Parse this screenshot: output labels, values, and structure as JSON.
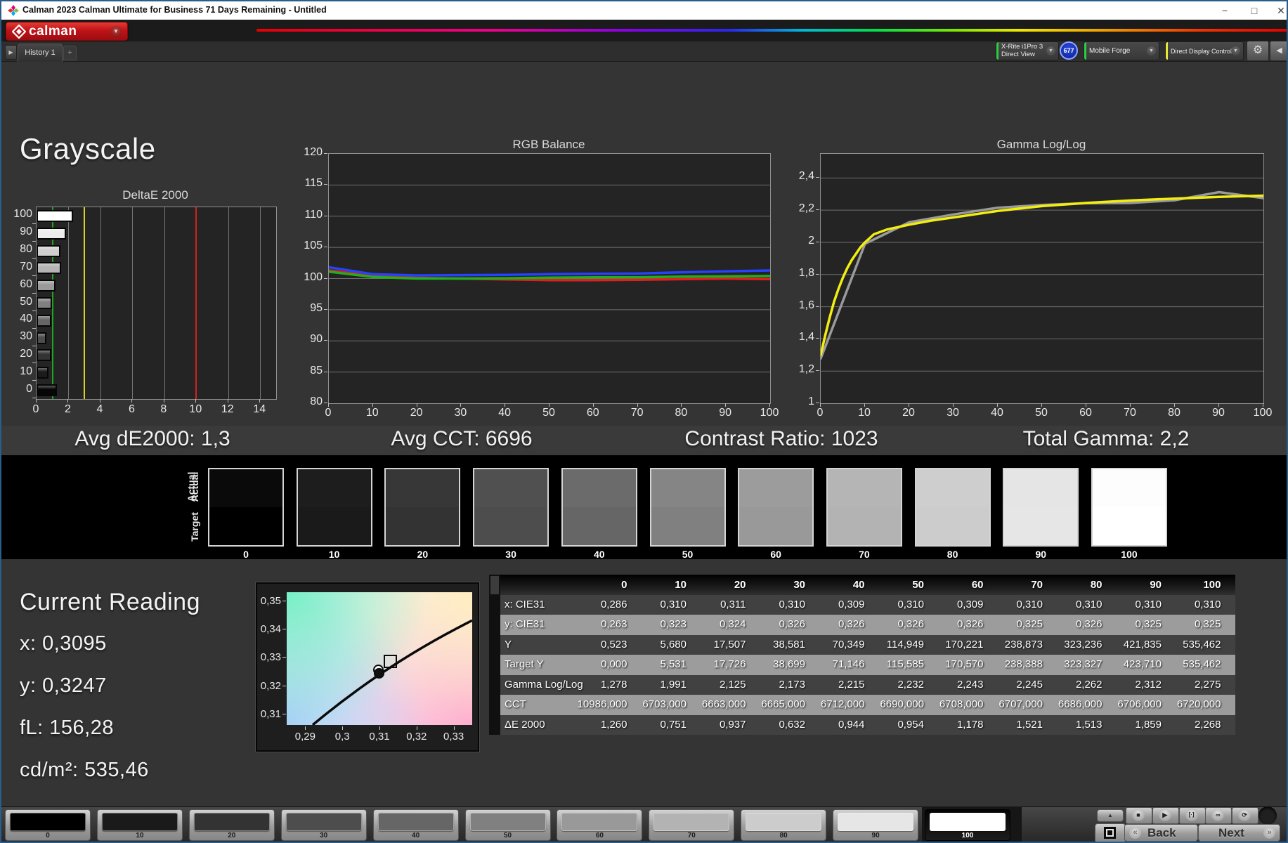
{
  "window": {
    "title": "Calman 2023 Calman Ultimate for Business 71 Days Remaining  - Untitled",
    "controls": [
      "−",
      "□",
      "✕"
    ]
  },
  "brand": {
    "logo_text": "calman"
  },
  "icons": {
    "caret_down": "▼",
    "tab_scroll": "▶",
    "gear": "⚙",
    "collapse": "◀",
    "up_arrow": "▲",
    "back_chevron": "«",
    "next_chevron": "»"
  },
  "toolbar": {
    "tab_label": "History 1",
    "add_label": "+",
    "meter": {
      "line1": "X-Rite i1Pro 3",
      "line2": "Direct View",
      "edge_color": "#2ecc40"
    },
    "meter_badge": "677",
    "source": {
      "label": "Mobile Forge",
      "edge_color": "#2ecc40"
    },
    "display": {
      "label": "Direct Display Control",
      "edge_color": "#e7e73a"
    }
  },
  "page": {
    "title": "Grayscale"
  },
  "summary": [
    "Avg dE2000: 1,3",
    "Avg CCT: 6696",
    "Contrast Ratio: 1023",
    "Total Gamma: 2,2"
  ],
  "reading": {
    "title": "Current Reading",
    "lines": [
      "x: 0,3095",
      "y: 0,3247",
      "fL: 156,28",
      "cd/m²: 535,46"
    ]
  },
  "swatches": {
    "row_labels": [
      "Actual",
      "Target"
    ],
    "levels": [
      "0",
      "10",
      "20",
      "30",
      "40",
      "50",
      "60",
      "70",
      "80",
      "90",
      "100"
    ],
    "actual_colors": [
      "#0a0a0a",
      "#1d1d1d",
      "#373737",
      "#505050",
      "#6b6b6b",
      "#858585",
      "#9c9c9c",
      "#b5b5b5",
      "#cecece",
      "#e5e5e5",
      "#fdfdfd"
    ],
    "target_colors": [
      "#000000",
      "#1a1a1a",
      "#333333",
      "#4d4d4d",
      "#666666",
      "#808080",
      "#999999",
      "#b3b3b3",
      "#cccccc",
      "#e6e6e6",
      "#ffffff"
    ]
  },
  "chart_data": [
    {
      "type": "bar",
      "title": "DeltaE 2000",
      "orientation": "horizontal",
      "categories": [
        "100",
        "90",
        "80",
        "70",
        "60",
        "50",
        "40",
        "30",
        "20",
        "10",
        "0"
      ],
      "values": [
        2.268,
        1.859,
        1.513,
        1.521,
        1.178,
        0.954,
        0.944,
        0.632,
        0.937,
        0.751,
        1.26
      ],
      "bar_colors": [
        "#ffffff",
        "#ececec",
        "#cfcfcf",
        "#b5b5b5",
        "#9a9a9a",
        "#808080",
        "#666666",
        "#4d4d4d",
        "#343434",
        "#1b1b1b",
        "#060606"
      ],
      "xlim": [
        0,
        15
      ],
      "xticks": [
        0,
        2,
        4,
        6,
        8,
        10,
        12,
        14
      ],
      "grid_values": [
        2,
        4,
        6,
        8,
        12,
        14
      ],
      "ref_lines": [
        {
          "name": "good",
          "value": 1,
          "color": "#1ea51e"
        },
        {
          "name": "warn",
          "value": 3,
          "color": "#d8d41c"
        },
        {
          "name": "bad",
          "value": 10,
          "color": "#d42020"
        }
      ]
    },
    {
      "type": "line",
      "title": "RGB Balance",
      "x": [
        0,
        10,
        20,
        30,
        40,
        50,
        60,
        70,
        80,
        90,
        100
      ],
      "xticks": [
        0,
        10,
        20,
        30,
        40,
        50,
        60,
        70,
        80,
        90,
        100
      ],
      "ylim": [
        80,
        120
      ],
      "yticks": [
        80,
        85,
        90,
        95,
        100,
        105,
        110,
        115,
        120
      ],
      "series": [
        {
          "name": "Red",
          "color": "#e02020",
          "values": [
            101.3,
            100.45,
            100.1,
            100.0,
            99.85,
            99.75,
            99.75,
            99.8,
            99.9,
            100.0,
            99.9
          ]
        },
        {
          "name": "Green",
          "color": "#1faf1f",
          "values": [
            101.1,
            100.25,
            100.0,
            100.0,
            100.05,
            100.15,
            100.2,
            100.2,
            100.3,
            100.35,
            100.4
          ]
        },
        {
          "name": "Blue",
          "color": "#2642ff",
          "values": [
            101.8,
            100.7,
            100.5,
            100.55,
            100.6,
            100.7,
            100.75,
            100.8,
            101.0,
            101.15,
            101.3
          ]
        }
      ]
    },
    {
      "type": "line",
      "title": "Gamma Log/Log",
      "xticks": [
        0,
        10,
        20,
        30,
        40,
        50,
        60,
        70,
        80,
        90,
        100
      ],
      "ylim": [
        1,
        2.55
      ],
      "yticks": [
        1,
        1.2,
        1.4,
        1.6,
        1.8,
        2,
        2.2,
        2.4
      ],
      "ytick_labels": [
        "1",
        "1,2",
        "1,4",
        "1,6",
        "1,8",
        "2",
        "2,2",
        "2,4"
      ],
      "series": [
        {
          "name": "Measured",
          "color": "#9a9a9a",
          "x": [
            0,
            10,
            20,
            30,
            40,
            50,
            60,
            70,
            80,
            90,
            100
          ],
          "values": [
            1.278,
            1.991,
            2.125,
            2.173,
            2.215,
            2.232,
            2.243,
            2.245,
            2.262,
            2.312,
            2.275
          ]
        },
        {
          "name": "Target",
          "color": "#f2ee10",
          "x": [
            0,
            1,
            2,
            3,
            4,
            5,
            6,
            7,
            8,
            9,
            10,
            12,
            15,
            20,
            25,
            30,
            40,
            50,
            60,
            70,
            80,
            90,
            100
          ],
          "values": [
            1.3,
            1.42,
            1.53,
            1.63,
            1.71,
            1.78,
            1.84,
            1.89,
            1.93,
            1.97,
            2.0,
            2.05,
            2.08,
            2.11,
            2.135,
            2.155,
            2.195,
            2.225,
            2.245,
            2.26,
            2.272,
            2.283,
            2.29
          ]
        }
      ]
    },
    {
      "type": "scatter",
      "title": "CIE xy chromaticity",
      "xlim": [
        0.285,
        0.335
      ],
      "ylim": [
        0.306,
        0.353
      ],
      "xticks": [
        0.29,
        0.3,
        0.31,
        0.32,
        0.33
      ],
      "xtick_labels": [
        "0,29",
        "0,3",
        "0,31",
        "0,32",
        "0,33"
      ],
      "yticks": [
        0.35,
        0.34,
        0.33,
        0.32,
        0.31
      ],
      "ytick_labels": [
        "0,35",
        "0,34",
        "0,33",
        "0,32",
        "0,31"
      ],
      "target_point": {
        "x": 0.3127,
        "y": 0.329,
        "marker": "square"
      },
      "measured_points": [
        {
          "x": 0.3095,
          "y": 0.326
        },
        {
          "x": 0.3096,
          "y": 0.3247
        }
      ],
      "locus": [
        [
          0.292,
          0.306
        ],
        [
          0.3115,
          0.3275
        ],
        [
          0.335,
          0.343
        ]
      ]
    },
    {
      "type": "table",
      "columns": [
        "0",
        "10",
        "20",
        "30",
        "40",
        "50",
        "60",
        "70",
        "80",
        "90",
        "100"
      ],
      "rows": [
        {
          "label": "x: CIE31",
          "values": [
            "0,286",
            "0,310",
            "0,311",
            "0,310",
            "0,309",
            "0,310",
            "0,309",
            "0,310",
            "0,310",
            "0,310",
            "0,310"
          ]
        },
        {
          "label": "y: CIE31",
          "values": [
            "0,263",
            "0,323",
            "0,324",
            "0,326",
            "0,326",
            "0,326",
            "0,326",
            "0,325",
            "0,326",
            "0,325",
            "0,325"
          ]
        },
        {
          "label": "Y",
          "values": [
            "0,523",
            "5,680",
            "17,507",
            "38,581",
            "70,349",
            "114,949",
            "170,221",
            "238,873",
            "323,236",
            "421,835",
            "535,462"
          ]
        },
        {
          "label": "Target Y",
          "values": [
            "0,000",
            "5,531",
            "17,726",
            "38,699",
            "71,146",
            "115,585",
            "170,570",
            "238,388",
            "323,327",
            "423,710",
            "535,462"
          ]
        },
        {
          "label": "Gamma Log/Log",
          "values": [
            "1,278",
            "1,991",
            "2,125",
            "2,173",
            "2,215",
            "2,232",
            "2,243",
            "2,245",
            "2,262",
            "2,312",
            "2,275"
          ]
        },
        {
          "label": "CCT",
          "values": [
            "10986,000",
            "6703,000",
            "6663,000",
            "6665,000",
            "6712,000",
            "6690,000",
            "6708,000",
            "6707,000",
            "6686,000",
            "6706,000",
            "6720,000"
          ]
        },
        {
          "label": "ΔE 2000",
          "values": [
            "1,260",
            "0,751",
            "0,937",
            "0,632",
            "0,944",
            "0,954",
            "1,178",
            "1,521",
            "1,513",
            "1,859",
            "2,268"
          ]
        }
      ]
    }
  ],
  "bottom_bar": {
    "levels": [
      "0",
      "10",
      "20",
      "30",
      "40",
      "50",
      "60",
      "70",
      "80",
      "90",
      "100"
    ],
    "level_colors": [
      "#000000",
      "#1a1a1a",
      "#333333",
      "#4d4d4d",
      "#666666",
      "#808080",
      "#999999",
      "#b3b3b3",
      "#cccccc",
      "#e6e6e6",
      "#ffffff"
    ],
    "selected_level": "100",
    "transport": [
      {
        "name": "stop",
        "glyph": "■"
      },
      {
        "name": "play",
        "glyph": "▶"
      },
      {
        "name": "single-measure",
        "glyph": "[·]"
      },
      {
        "name": "continuous",
        "glyph": "∞"
      },
      {
        "name": "loop",
        "glyph": "⟳"
      }
    ],
    "back_label": "Back",
    "next_label": "Next"
  }
}
